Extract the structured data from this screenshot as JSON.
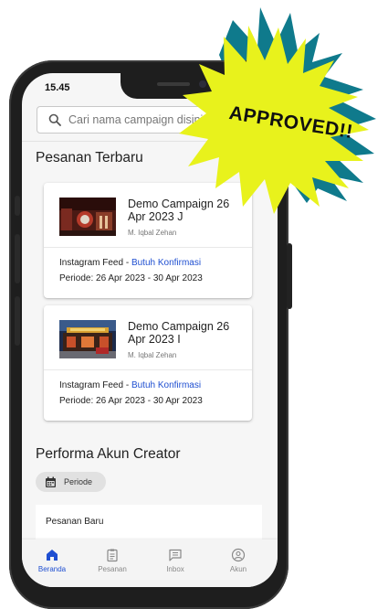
{
  "status_bar": {
    "time": "15.45"
  },
  "search": {
    "placeholder": "Cari nama campaign disini..."
  },
  "sections": {
    "recent_orders": "Pesanan Terbaru",
    "performance": "Performa Akun Creator"
  },
  "orders": [
    {
      "title": "Demo Campaign 26 Apr 2023 J",
      "author": "M. Iqbal Zehan",
      "platform": "Instagram Feed",
      "separator": " - ",
      "status": "Butuh Konfirmasi",
      "period": "Periode: 26 Apr 2023 - 30 Apr 2023"
    },
    {
      "title": "Demo Campaign 26 Apr 2023 I",
      "author": "M. Iqbal Zehan",
      "platform": "Instagram Feed",
      "separator": " - ",
      "status": "Butuh Konfirmasi",
      "period": "Periode: 26 Apr 2023 - 30 Apr 2023"
    }
  ],
  "filter_chip": {
    "label": "Periode",
    "icon": "calendar-icon"
  },
  "panel": {
    "label": "Pesanan Baru"
  },
  "nav": [
    {
      "label": "Beranda",
      "icon": "home-icon",
      "active": true
    },
    {
      "label": "Pesanan",
      "icon": "clipboard-icon",
      "active": false
    },
    {
      "label": "Inbox",
      "icon": "chat-icon",
      "active": false
    },
    {
      "label": "Akun",
      "icon": "account-icon",
      "active": false
    }
  ],
  "sticker": {
    "text": "APPROVED!!"
  },
  "colors": {
    "accent": "#1f4fd1",
    "burst_yellow": "#e8f21c",
    "burst_teal": "#0f7a8c",
    "phone_frame": "#1e1e1e"
  }
}
